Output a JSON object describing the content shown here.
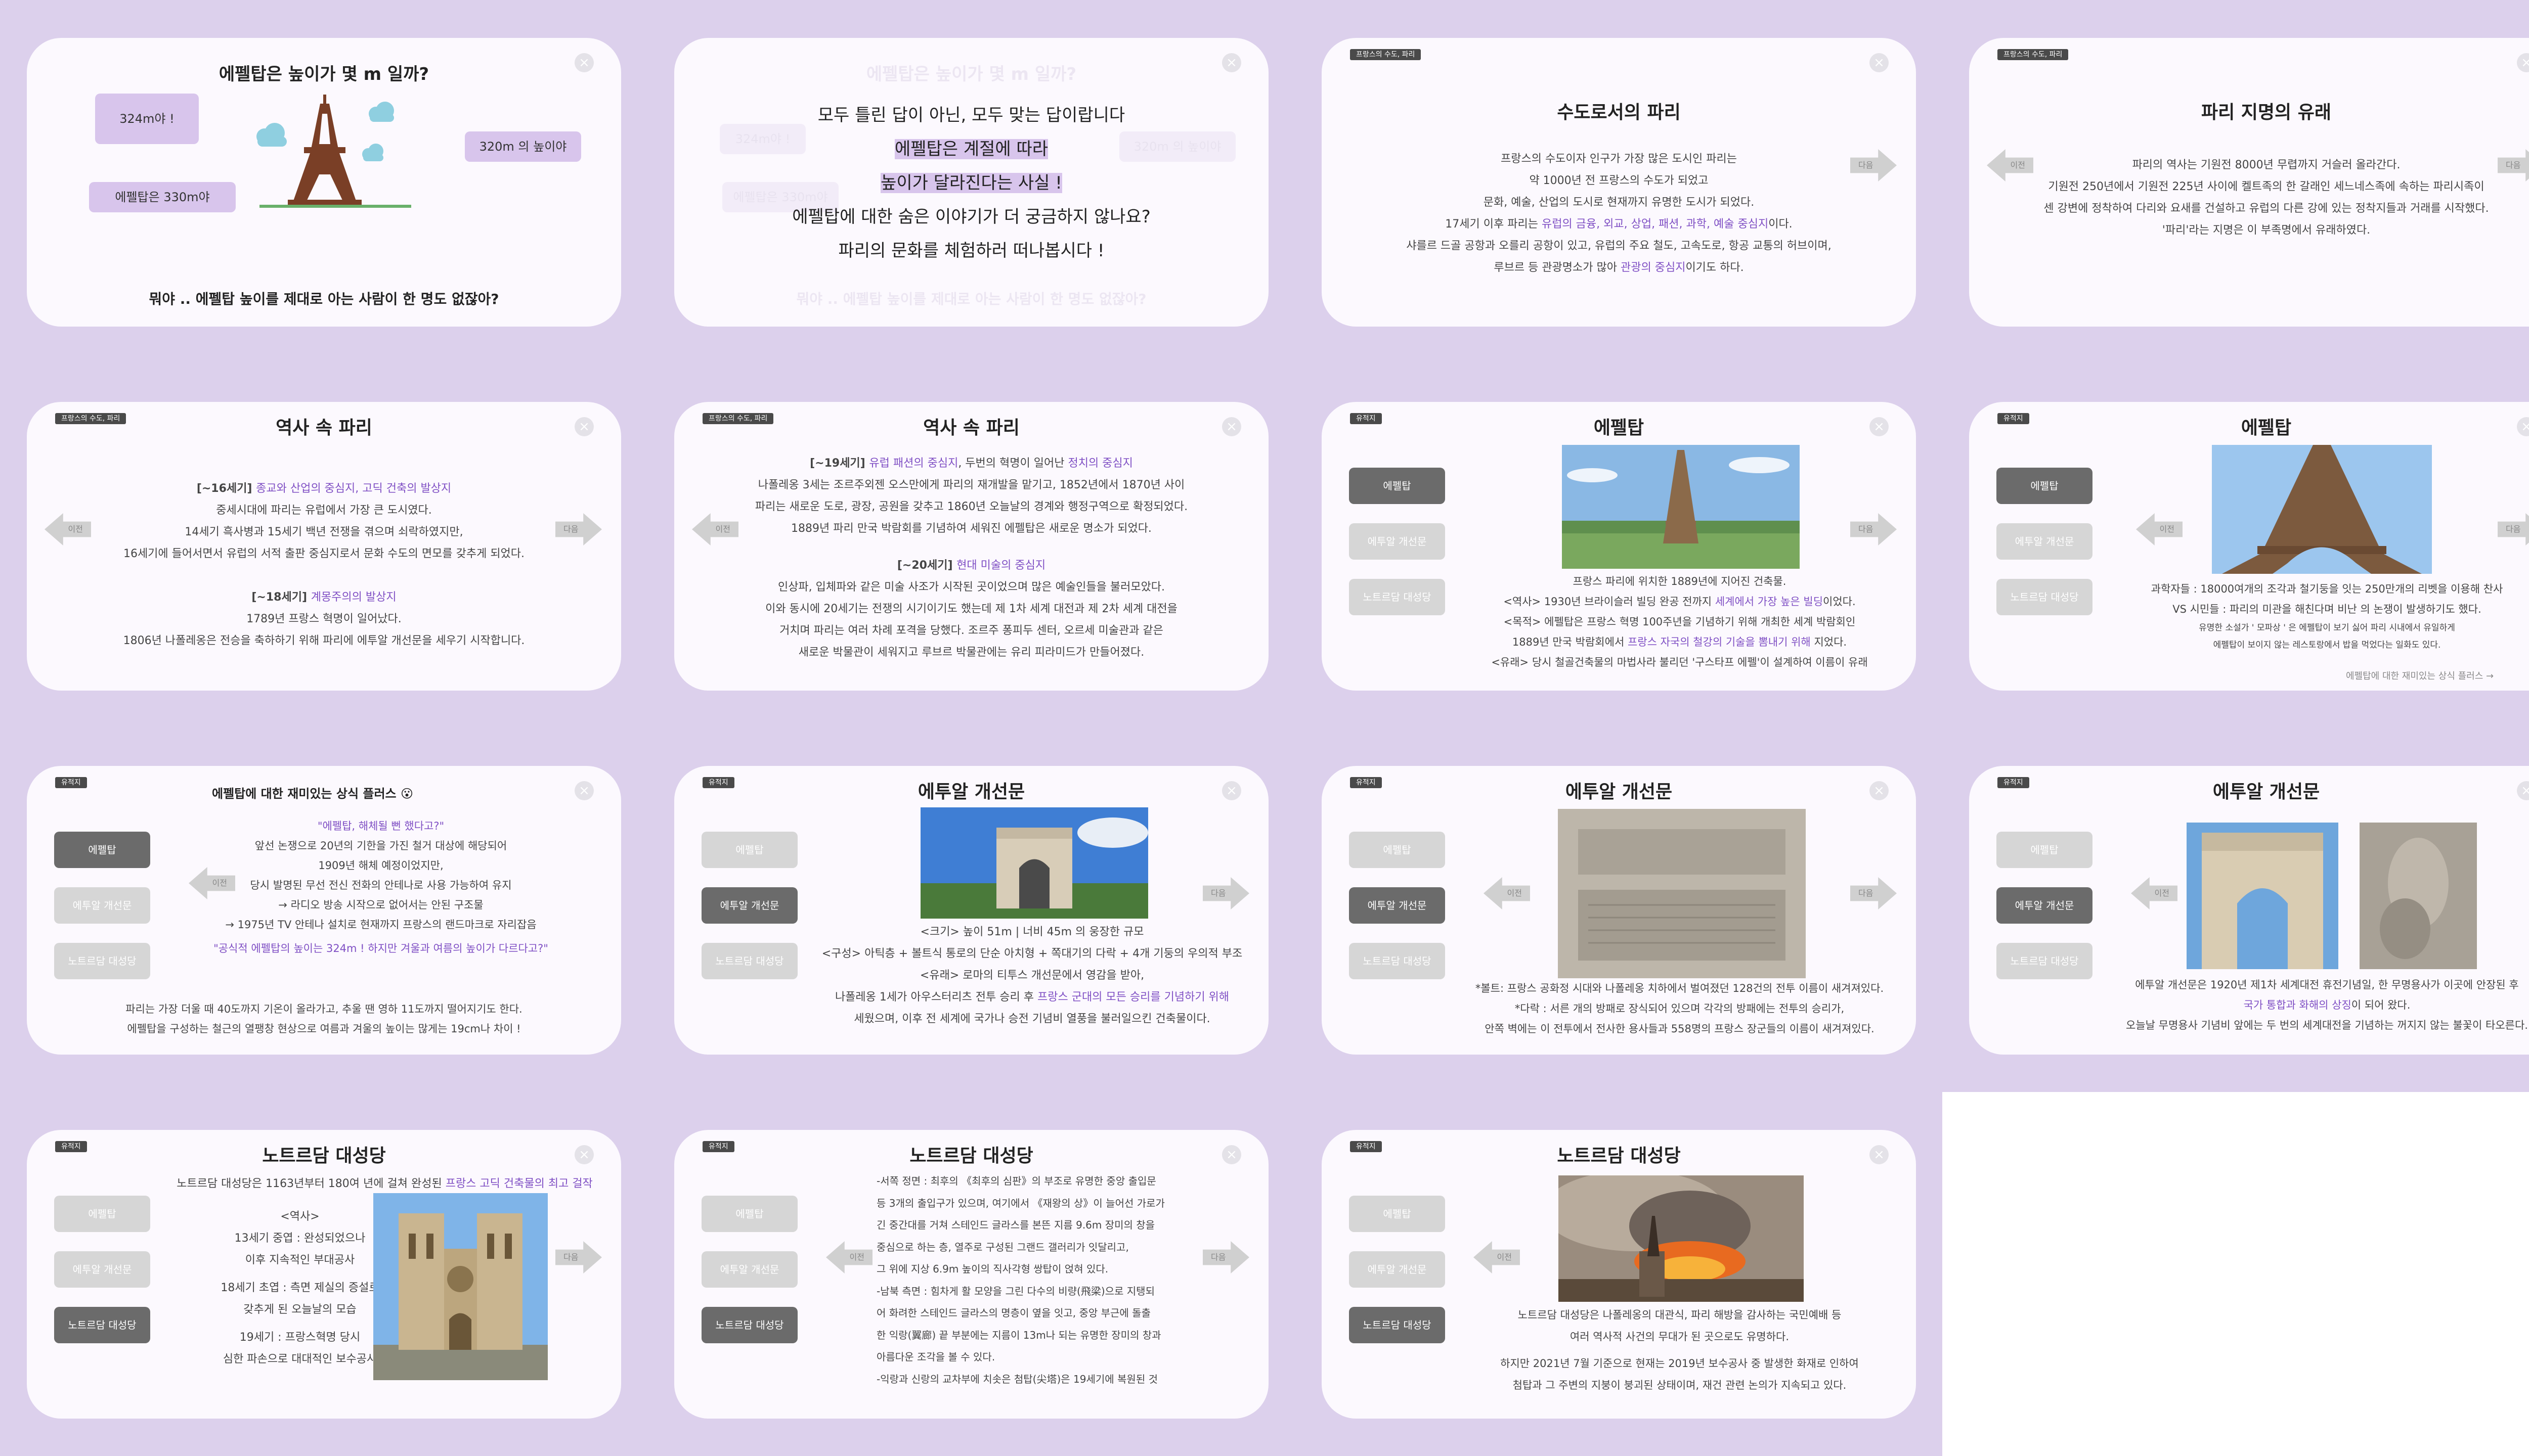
{
  "common": {
    "close": "×",
    "prev": "이전",
    "next": "다음"
  },
  "s1": {
    "title": "에펠탑은 높이가 몇 m 일까?",
    "b1": "324m야 !",
    "b2": "에펠탑은 330m야",
    "b3": "320m 의 높이야",
    "bottom": "뭐야 .. 에펠탑 높이를 제대로 아는 사람이 한 명도 없잖아?"
  },
  "s2": {
    "ghost_title": "에펠탑은 높이가 몇 m 일까?",
    "ghost_bottom": "뭐야 .. 에펠탑 높이를 제대로 아는 사람이 한 명도 없잖아?",
    "ghost_b1": "324m야 !",
    "ghost_b2": "에펠탑은 330m야",
    "ghost_b3": "320m 의 높이야",
    "lines": [
      "모두 틀린 답이 아닌, 모두 맞는 답이랍니다",
      "에펠탑은 계절에 따라",
      "높이가 달라진다는 사실 !",
      "에펠탑에 대한 숨은 이야기가 더 궁금하지 않나요?",
      "파리의 문화를 체험하러 떠나봅시다 !"
    ]
  },
  "s3": {
    "tag": "프랑스의 수도, 파리",
    "title": "수도로서의 파리",
    "l1": "프랑스의 수도이자 인구가 가장 많은 도시인 파리는",
    "l2": "약 1000년 전 프랑스의 수도가 되었고",
    "l3": "문화, 예술, 산업의 도시로 현재까지 유명한 도시가 되었다.",
    "l4a": "17세기 이후 파리는 ",
    "l4b": "유럽의 금융, 외교, 상업, 패션, 과학, 예술 중심지",
    "l4c": "이다.",
    "l5": "샤를르 드골 공항과 오를리 공항이 있고, 유럽의 주요 철도, 고속도로, 항공 교통의 허브이며,",
    "l6a": "루브르 등 관광명소가 많아 ",
    "l6b": "관광의 중심지",
    "l6c": "이기도 하다."
  },
  "s4": {
    "tag": "프랑스의 수도, 파리",
    "title": "파리 지명의 유래",
    "l1": "파리의 역사는 기원전 8000년 무렵까지 거슬러 올라간다.",
    "l2": "기원전 250년에서 기원전 225년 사이에 켈트족의 한 갈래인 세느네스족에 속하는 파리시족이",
    "l3": "센 강변에 정착하여 다리와 요새를 건설하고 유럽의 다른 강에 있는 정착지들과 거래를 시작했다.",
    "l4": "'파리'라는 지명은 이 부족명에서 유래하였다."
  },
  "s5": {
    "tag": "프랑스의 수도, 파리",
    "title": "역사 속 파리",
    "h1a": "[~16세기] ",
    "h1b": "종교와 산업의 중심지, 고딕 건축의 발상지",
    "l1": "중세시대에 파리는 유럽에서 가장 큰 도시였다.",
    "l2": "14세기 흑사병과 15세기 백년 전쟁을 겪으며 쇠락하였지만,",
    "l3": "16세기에 들어서면서 유럽의 서적 출판 중심지로서 문화 수도의 면모를 갖추게 되었다.",
    "h2a": "[~18세기] ",
    "h2b": "계몽주의의 발상지",
    "l4": "1789년 프랑스 혁명이 일어났다.",
    "l5": "1806년 나폴레옹은 전승을 축하하기 위해 파리에 에투알 개선문을 세우기 시작합니다."
  },
  "s6": {
    "tag": "프랑스의 수도, 파리",
    "title": "역사 속 파리",
    "h1a": "[~19세기] ",
    "h1b": "유럽 패션의 중심지",
    "h1c": ", 두번의 혁명이 일어난 ",
    "h1d": "정치의 중심지",
    "l1": "나폴레옹 3세는 조르주외젠 오스만에게 파리의 재개발을 맡기고, 1852년에서 1870년 사이",
    "l2": "파리는 새로운 도로, 광장, 공원을 갖추고 1860년 오늘날의 경계와 행정구역으로 확정되었다.",
    "l3": "1889년 파리 만국 박람회를 기념하여 세워진 에펠탑은 새로운 명소가 되었다.",
    "h2a": "[~20세기] ",
    "h2b": "현대 미술의 중심지",
    "l4": "인상파, 입체파와 같은 미술 사조가 시작된 곳이었으며 많은 예술인들을 불러모았다.",
    "l5": "이와 동시에 20세기는 전쟁의 시기이기도 했는데 제 1차 세계 대전과 제 2차 세계 대전을",
    "l6": "거치며 파리는 여러 차례 포격을 당했다. 조르주 퐁피두 센터, 오르세 미술관과 같은",
    "l7": "새로운 박물관이 세워지고 루브르 박물관에는 유리 피라미드가 만들어졌다."
  },
  "sidebar": {
    "tag": "유적지",
    "eiffel": "에펠탑",
    "arc": "에투알 개선문",
    "notre": "노트르담 대성당"
  },
  "s7": {
    "title": "에펠탑",
    "l1": "프랑스 파리에 위치한 1889년에 지어진 건축물.",
    "l2a": "<역사> 1930년 브라이슬러 빌딩 완공 전까지 ",
    "l2b": "세계에서 가장 높은 빌딩",
    "l2c": "이었다.",
    "l3": "<목적> 에펠탑은 프랑스 혁명 100주년을 기념하기 위해 개최한 세계 박람회인",
    "l4a": "1889년 만국 박람회에서 ",
    "l4b": "프랑스 자국의 철강의 기술을 뽐내기 위해",
    "l4c": " 지었다.",
    "l5": "<유래> 당시 철골건축물의 마법사라 불리던 '구스타프 에펠'이 설계하여 이름이 유래"
  },
  "s8": {
    "title": "에펠탑",
    "l1": "과학자들 : 18000여개의 조각과 철기둥을 잇는 250만개의 리벳을 이용해 찬사",
    "l2": "VS 시민들 : 파리의 미관을 해친다며 비난 의 논쟁이 발생하기도 했다.",
    "l3": "유명한 소설가 ' 모파상 ' 은 에펠탑이 보기 싫어 파리 시내에서 유일하게",
    "l4": "에펠탑이 보이지 않는 레스토랑에서 밥을 먹었다는 일화도 있다.",
    "more": "에펠탑에 대한 재미있는 상식 플러스 →"
  },
  "s9": {
    "title": "에펠탑에 대한 재미있는 상식 플러스 😮",
    "q1": "\"에펠탑, 해체될 뻔 했다고?\"",
    "l1": "앞선 논쟁으로 20년의 기한을 가진 철거 대상에 해당되어",
    "l2": "1909년 해체 예정이었지만,",
    "l3": "당시 발명된 무선 전신 전화의 안테나로 사용 가능하여 유지",
    "l4": "→ 라디오 방송 시작으로 없어서는 안된 구조물",
    "l5": "→ 1975년 TV 안테나 설치로 현재까지 프랑스의 랜드마크로 자리잡음",
    "q2": "\"공식적 에펠탑의 높이는 324m ! 하지만 겨울과 여름의 높이가 다르다고?\"",
    "l6": "파리는 가장 더울 때 40도까지 기온이 올라가고, 추울 땐 영하 11도까지 떨어지기도 한다.",
    "l7": "에펠탑을 구성하는 철근의 열팽창 현상으로 여름과 겨울의 높이는 많게는 19cm나 차이 !"
  },
  "s10": {
    "title": "에투알 개선문",
    "l1": "<크기> 높이 51m | 너비 45m 의 웅장한 규모",
    "l2": "<구성> 아틱층 + 볼트식 통로의 단순 아치형 + 쪽대기의 다락 + 4개 기둥의 우의적 부조",
    "l3": "<유래> 로마의 티투스 개선문에서 영감을 받아,",
    "l4a": "나폴레옹 1세가 아우스터리츠 전투 승리 후 ",
    "l4b": "프랑스 군대의 모든 승리를 기념하기 위해",
    "l5": "세웠으며, 이후 전 세계에 국가나 승전 기념비 열풍을 불러일으킨 건축물이다."
  },
  "s11": {
    "title": "에투알 개선문",
    "l1": "*볼트: 프랑스 공화정 시대와 나폴레옹 치하에서 벌여졌던 128건의 전투 이름이 새겨져있다.",
    "l2": "*다락 : 서른 개의 방패로 장식되어 있으며 각각의 방패에는 전투의 승리가,",
    "l3": "안쪽 벽에는 이 전투에서 전사한 용사들과 558명의 프랑스 장군들의 이름이 새겨져있다."
  },
  "s12": {
    "title": "에투알 개선문",
    "l1": "에투알 개선문은 1920년 제1차 세계대전 휴전기념일, 한 무명용사가 이곳에 안장된 후",
    "l2a": "",
    "l2b": "국가 통합과 화해의 상징",
    "l2c": "이 되어 왔다.",
    "l3": "오늘날 무명용사 기념비 앞에는 두 번의 세계대전을 기념하는 꺼지지 않는 불꽃이 타오른다."
  },
  "s13": {
    "title": "노트르담 대성당",
    "l1a": "노트르담 대성당은 1163년부터 180여 년에 걸쳐 완성된 ",
    "l1b": "프랑스 고딕 건축물의 최고 걸작",
    "l2": "<역사>",
    "l3": "13세기 중엽 : 완성되었으나",
    "l4": "이후 지속적인 부대공사",
    "l5": "18세기 초엽 : 측면 제실의 증설로",
    "l6": "갖추게 된 오늘날의 모습",
    "l7": "19세기 : 프랑스혁명 당시",
    "l8": "심한 파손으로 대대적인 보수공사"
  },
  "s14": {
    "title": "노트르담 대성당",
    "l1": "-서쪽 정면 : 최후의 《최후의 심판》의 부조로 유명한 중앙 출입문",
    "l2": "등 3개의 출입구가 있으며, 여기에서 《재왕의 상》이 늘어선 가로가",
    "l3": "긴 중간대를 거쳐 스테인드 글라스를 본뜬 지름 9.6m 장미의 창을",
    "l4": "중심으로 하는 층, 열주로 구성된 그랜드 갤러리가 잇달리고,",
    "l5": "그 위에 지상 6.9m 높이의 직사각형 쌍탑이 얹혀 있다.",
    "l6": "-남북 측면 : 힘차게 활 모양을 그린 다수의 비량(飛梁)으로 지탱되",
    "l7": "어 화려한 스테인드 글라스의 명층이 옆을 잇고, 중앙 부근에 돌출",
    "l8": "한 익랑(翼廊) 끝 부분에는 지름이 13m나 되는 유명한 장미의 창과",
    "l9": "아름다운 조각을 볼 수 있다.",
    "l10": "-익랑과 신랑의 교차부에 치솟은 첨탑(尖塔)은 19세기에 복원된 것"
  },
  "s15": {
    "title": "노트르담 대성당",
    "l1": "노트르담 대성당은 나폴레옹의 대관식, 파리 해방을 감사하는 국민예배 등",
    "l2": "여러 역사적 사건의 무대가 된 곳으로도 유명하다.",
    "l3": "하지만 2021년 7월 기준으로 현재는 2019년 보수공사 중 발생한 화재로 인하여",
    "l4": "첨탑과 그 주변의 지붕이 붕괴된 상태이며, 재건 관련 논의가 지속되고 있다."
  },
  "colors": {
    "background": "#dcd0ec",
    "card": "#fcf9fe",
    "highlight": "#7f4fc4",
    "bubble": "#d8c5ec",
    "sideActive": "#6b6b6b",
    "sideInactive": "#d6d6d6"
  }
}
